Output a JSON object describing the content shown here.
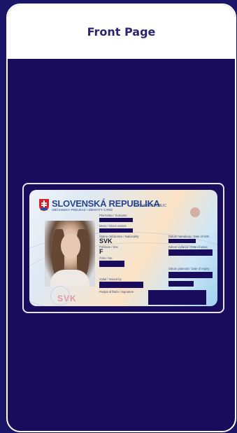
{
  "header": {
    "title": "Front Page"
  },
  "card": {
    "country": "SLOVENSKÁ REPUBLIKA",
    "country_en": "SLOVAK REPUBLIC",
    "doc_type": "OBČIANSKY PREUKAZ / IDENTITY CARD",
    "surname_label": "Priezvisko / Surname",
    "given_label": "Meno / Given names",
    "nationality_label": "Štátne občianstvo / Nationality",
    "nationality_value": "SVK",
    "sex_label": "Pohlavie / Sex",
    "sex_value": "F",
    "doc_no_label": "Číslo / No.",
    "dob_label": "Dátum narodenia / Date of birth",
    "issue_label": "Dátum vydania / Date of issue",
    "expiry_label": "Dátum platnosti / Date of expiry",
    "issued_by_label": "Vydal / Issued by",
    "can_label": "Podpis držiteľa / Signature",
    "holo_text": "SVK"
  },
  "colors": {
    "background": "#1c1668",
    "panel": "#1a0c5c",
    "header_text": "#2b2670"
  }
}
